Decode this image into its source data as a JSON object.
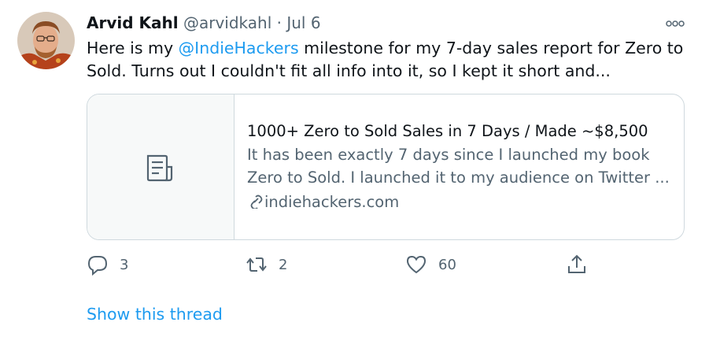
{
  "tweet": {
    "author_name": "Arvid Kahl",
    "handle": "@arvidkahl",
    "separator": "·",
    "date": "Jul 6",
    "text_prefix": "Here is my ",
    "mention": "@IndieHackers",
    "text_suffix": " milestone for my 7-day sales report for Zero to Sold. Turns out I couldn't fit all info into it, so I kept it short and...",
    "more_icon": "more-options-icon"
  },
  "card": {
    "title": "1000+ Zero to Sold Sales in 7 Days / Made ~$8,500",
    "description": "It has been exactly 7 days since I launched my book Zero to Sold. I launched it to my audience on Twitter ...",
    "domain": "indiehackers.com",
    "thumbnail_icon": "document-icon",
    "link_icon": "link-icon"
  },
  "actions": {
    "reply_count": "3",
    "retweet_count": "2",
    "like_count": "60"
  },
  "show_thread_label": "Show this thread",
  "colors": {
    "accent": "#1d9bf0",
    "secondary_text": "#536471",
    "border": "#cfd9de"
  }
}
